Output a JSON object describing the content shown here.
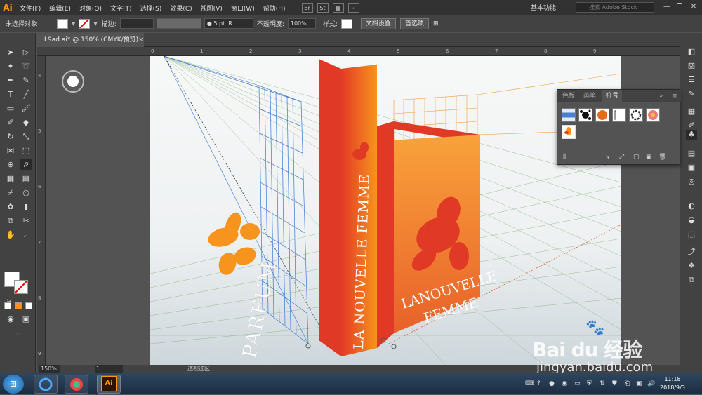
{
  "app": {
    "logo": "Ai"
  },
  "menu": [
    "文件(F)",
    "编辑(E)",
    "对象(O)",
    "文字(T)",
    "选择(S)",
    "效果(C)",
    "视图(V)",
    "窗口(W)",
    "帮助(H)"
  ],
  "menu_icons": [
    "Br",
    "St",
    "▦",
    "⌁"
  ],
  "workspace": "基本功能",
  "stock_search": {
    "placeholder": "搜索 Adobe Stock"
  },
  "window_controls": [
    "—",
    "❐",
    "✕"
  ],
  "control_bar": {
    "selection": "未选择对象",
    "stroke_label": "描边:",
    "brush": "● 5 pt. R...",
    "opacity_label": "不透明度:",
    "opacity": "100%",
    "style_label": "样式:",
    "doc_settings": "文档设置",
    "preferences": "首选项"
  },
  "document_tab": {
    "title": "L9ad.ai* @ 150% (CMYK/预览)",
    "close": "×"
  },
  "ruler": {
    "h": [
      "0",
      "1",
      "2",
      "3",
      "4",
      "5",
      "6",
      "7",
      "8",
      "9"
    ],
    "v": [
      "4",
      "5",
      "6",
      "7",
      "8",
      "9"
    ]
  },
  "artwork": {
    "left_text": "PARFUM",
    "tall_text": "LA NOUVELLE FEMME",
    "box_text_1": "LANOUVELLE",
    "box_text_2": "FEMME"
  },
  "status": {
    "zoom": "150%",
    "page": "1",
    "tool": "透视选区"
  },
  "symbols_panel": {
    "tabs": [
      "色板",
      "画笔",
      "符号"
    ],
    "active_tab": "符号",
    "menu": "≡",
    "collapse": "»",
    "footer_icons": [
      "⫼",
      "↳",
      "⤢",
      "▢",
      "▣",
      "🗑"
    ]
  },
  "taskbar": {
    "time": "11:18",
    "date": "2018/9/3",
    "start": "⊞",
    "ai_label": "Ai"
  },
  "watermark": {
    "logo": "Bai du 经验",
    "paw": "🐾",
    "url": "jingyan.baidu.com"
  },
  "colors": {
    "orange": "#f7941d",
    "red": "#e03a26",
    "grid_blue": "#3a78d8",
    "grid_orange": "#f29a3a"
  }
}
